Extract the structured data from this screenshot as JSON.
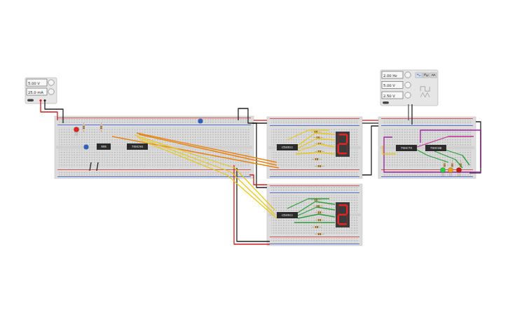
{
  "power_supply": {
    "voltage": "5.00 V",
    "current": "25.0 mA",
    "on": true
  },
  "function_generator": {
    "frequency": "2.00 Hz",
    "amplitude": "5.00 V",
    "offset": "2.50 V",
    "on": true,
    "waveforms": [
      {
        "kind": "sine",
        "selected": true
      },
      {
        "kind": "square",
        "selected": false
      },
      {
        "kind": "triangle",
        "selected": false
      }
    ]
  },
  "chips": [
    {
      "label": "555"
    },
    {
      "label": "74HC93"
    },
    {
      "label": "CD4511"
    },
    {
      "label": "CD4511"
    },
    {
      "label": "74HC74"
    },
    {
      "label": "74HC08"
    }
  ],
  "displays": [
    {
      "digit": "2"
    },
    {
      "digit": "2"
    }
  ],
  "leds": [
    {
      "color": "#e02424"
    },
    {
      "color": "#2ecc40"
    },
    {
      "color": "#e8a020"
    },
    {
      "color": "#c81818"
    }
  ]
}
